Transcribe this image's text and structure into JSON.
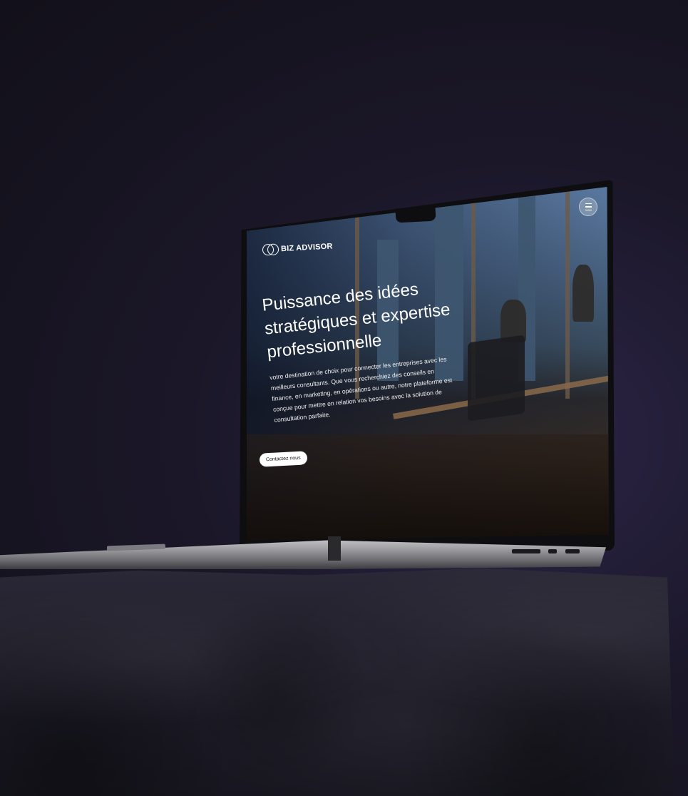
{
  "brand": {
    "logo_icon": "interlocking-rings-icon",
    "name": "BIZ ADVISOR"
  },
  "nav": {
    "menu_icon": "hamburger-menu-icon"
  },
  "hero": {
    "title": "Puissance des idées stratégiques et expertise professionnelle",
    "description": "votre destination de choix pour connecter les entreprises avec les meilleurs consultants. Que vous recherchiez des conseils en finance, en marketing, en opérations ou autre, notre plateforme est conçue pour mettre en relation vos besoins avec la solution de consultation parfaite.",
    "cta_label": "Contactez nous"
  },
  "colors": {
    "background": "#1b1729",
    "text": "#ffffff",
    "cta_bg": "#ffffff"
  }
}
